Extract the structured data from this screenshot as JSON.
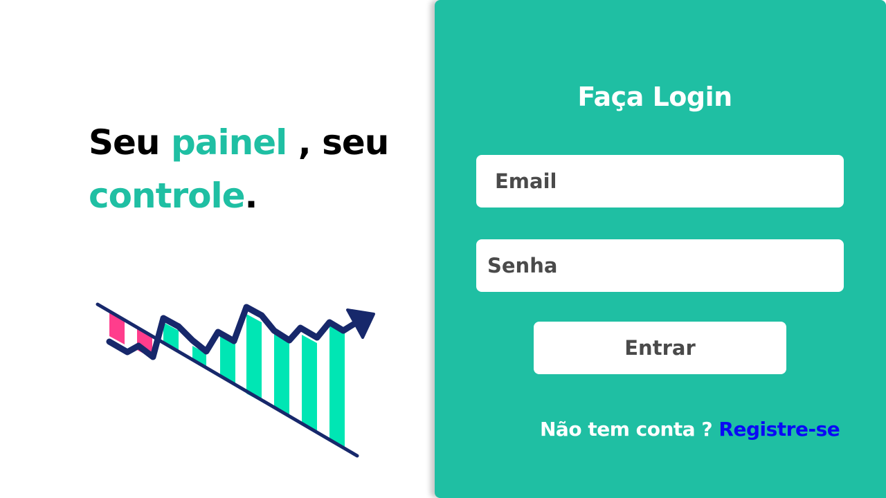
{
  "hero": {
    "word_seu": "Seu",
    "word_painel": "painel",
    "word_comma_seu": ", seu",
    "word_controle": "controle",
    "word_period": "."
  },
  "login": {
    "title": "Faça Login",
    "email_placeholder": "Email",
    "password_placeholder": "Senha",
    "submit_label": "Entrar",
    "no_account_text": "Não tem conta ?",
    "register_link": "Registre-se"
  },
  "colors": {
    "accent": "#1fbfa3",
    "bar_green": "#00e6b4",
    "bar_pink": "#ff3d8c",
    "line_navy": "#17286b",
    "link_blue": "#0a0af5"
  },
  "icons": {
    "illustration": "trending-up-chart-icon"
  }
}
